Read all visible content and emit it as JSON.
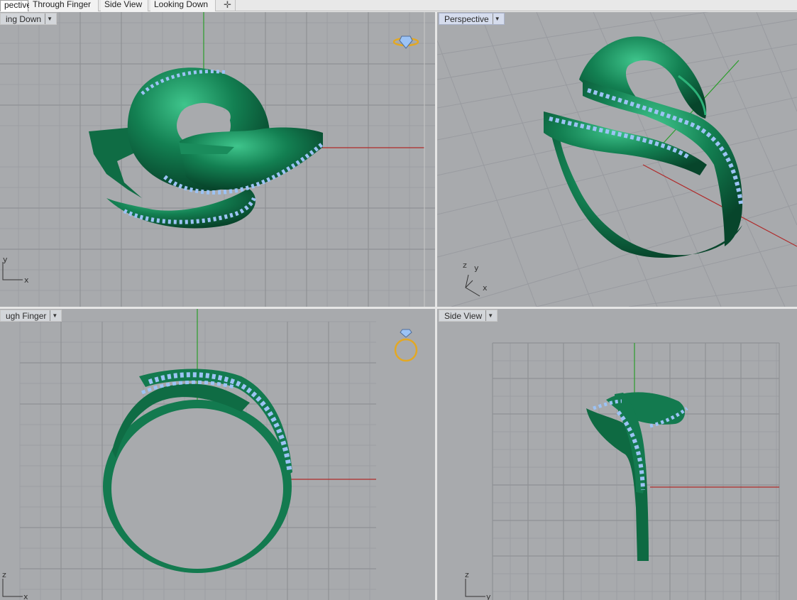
{
  "tabs": [
    {
      "label": "pective",
      "active": true
    },
    {
      "label": "Through Finger",
      "active": false
    },
    {
      "label": "Side View",
      "active": false
    },
    {
      "label": "Looking Down",
      "active": false
    }
  ],
  "add_tab_icon": "plus-icon",
  "viewports": {
    "top_left": {
      "label": "ing Down",
      "axis_x": "x",
      "axis_y": "y",
      "widget_icon": "ring-top-icon",
      "active": false
    },
    "top_right": {
      "label": "Perspective",
      "axis_x": "x",
      "axis_y": "y",
      "axis_z": "z",
      "active": true
    },
    "bottom_left": {
      "label": "ugh Finger",
      "axis_x": "x",
      "axis_z": "z",
      "widget_icon": "ring-front-icon",
      "active": false
    },
    "bottom_right": {
      "label": "Side View",
      "axis_y": "y",
      "axis_z": "z",
      "active": false
    }
  },
  "colors": {
    "viewport_bg": "#a8aaad",
    "grid": "#9a9ca0",
    "x_axis": "#b02a2a",
    "y_axis": "#2a9d2a",
    "ring_green": "#137a4f",
    "gem_blue": "#9cc3f5",
    "gold_widget": "#e3a823"
  }
}
